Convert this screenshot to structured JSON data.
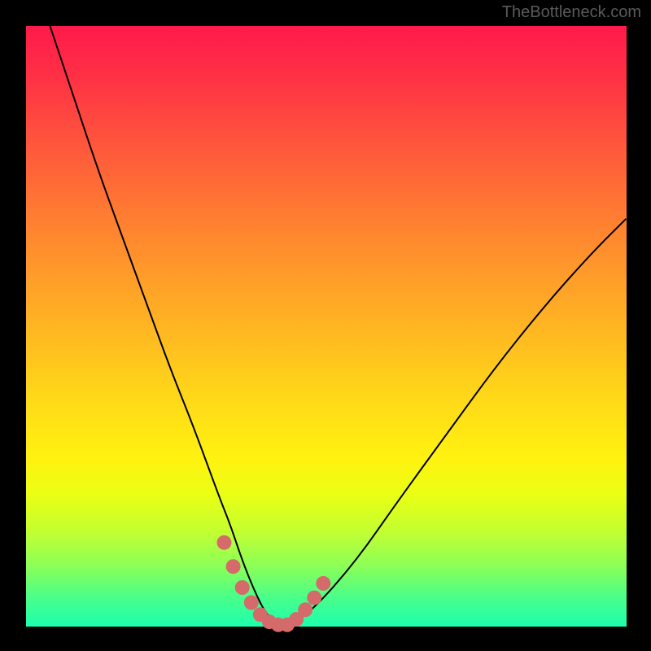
{
  "watermark": "TheBottleneck.com",
  "chart_data": {
    "type": "line",
    "title": "",
    "xlabel": "",
    "ylabel": "",
    "xlim": [
      0,
      100
    ],
    "ylim": [
      0,
      100
    ],
    "grid": false,
    "series": [
      {
        "name": "bottleneck-curve",
        "x": [
          4,
          8,
          12,
          16,
          20,
          24,
          28,
          32,
          34,
          36,
          38,
          40,
          42,
          44,
          48,
          55,
          62,
          70,
          78,
          86,
          94,
          100
        ],
        "y": [
          100,
          88,
          76,
          65,
          54,
          43,
          33,
          22,
          17,
          11,
          6,
          2,
          0.3,
          0.3,
          3,
          11,
          21,
          32,
          43,
          53,
          62,
          68
        ]
      }
    ],
    "highlight": {
      "name": "valley-highlight",
      "color": "#d46a6a",
      "x": [
        33,
        34.5,
        36,
        37.5,
        39,
        40.5,
        42,
        43.5,
        45,
        46.5,
        48,
        49.5
      ],
      "y": [
        14,
        10,
        6.5,
        4,
        2,
        0.8,
        0.3,
        0.3,
        1.2,
        2.8,
        4.8,
        7.2
      ]
    }
  }
}
